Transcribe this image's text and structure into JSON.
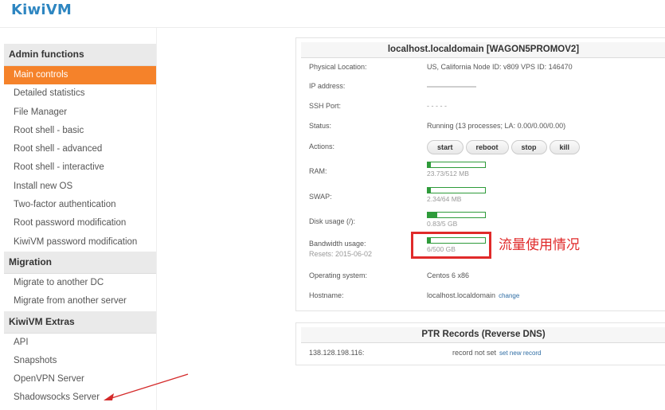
{
  "app": {
    "logo": "KiwiVM"
  },
  "sidebar": {
    "sections": [
      {
        "title": "Admin functions",
        "items": [
          {
            "label": "Main controls",
            "active": true
          },
          {
            "label": "Detailed statistics"
          },
          {
            "label": "File Manager"
          },
          {
            "label": "Root shell - basic"
          },
          {
            "label": "Root shell - advanced"
          },
          {
            "label": "Root shell - interactive"
          },
          {
            "label": "Install new OS"
          },
          {
            "label": "Two-factor authentication"
          },
          {
            "label": "Root password modification"
          },
          {
            "label": "KiwiVM password modification"
          }
        ]
      },
      {
        "title": "Migration",
        "items": [
          {
            "label": "Migrate to another DC"
          },
          {
            "label": "Migrate from another server"
          }
        ]
      },
      {
        "title": "KiwiVM Extras",
        "items": [
          {
            "label": "API"
          },
          {
            "label": "Snapshots"
          },
          {
            "label": "OpenVPN Server"
          },
          {
            "label": "Shadowsocks Server"
          }
        ]
      }
    ]
  },
  "server": {
    "title": "localhost.localdomain   [WAGON5PROMOV2]",
    "physical_location_label": "Physical Location:",
    "physical_location": "US, California   Node ID: v809   VPS ID: 146470",
    "ip_label": "IP address:",
    "ip_value": "",
    "ssh_label": "SSH Port:",
    "ssh_value": "- - - - -",
    "status_label": "Status:",
    "status_value": "Running (13 processes; LA: 0.00/0.00/0.00)",
    "actions_label": "Actions:",
    "actions": {
      "start": "start",
      "reboot": "reboot",
      "stop": "stop",
      "kill": "kill"
    },
    "ram_label": "RAM:",
    "ram_text": "23.73/512 MB",
    "ram_fraction": 0.046,
    "swap_label": "SWAP:",
    "swap_text": "2.34/64 MB",
    "swap_fraction": 0.037,
    "disk_label": "Disk usage (/):",
    "disk_text": "0.83/5 GB",
    "disk_fraction": 0.166,
    "bandwidth_label": "Bandwidth usage:",
    "bandwidth_resets": "Resets: 2015-06-02",
    "bandwidth_text": "6/500 GB",
    "bandwidth_fraction": 0.012,
    "os_label": "Operating system:",
    "os_value": "Centos 6 x86",
    "hostname_label": "Hostname:",
    "hostname_value": "localhost.localdomain",
    "hostname_change": "change"
  },
  "ptr": {
    "title": "PTR Records (Reverse DNS)",
    "ip": "138.128.198.116:",
    "status": "record not set",
    "action": "set new record"
  },
  "annotation": {
    "text": "流量使用情况",
    "color": "#e02a2a"
  },
  "colors": {
    "accent": "#f5822a",
    "bar": "#2e9b3a",
    "logo": "#2e86c1"
  }
}
